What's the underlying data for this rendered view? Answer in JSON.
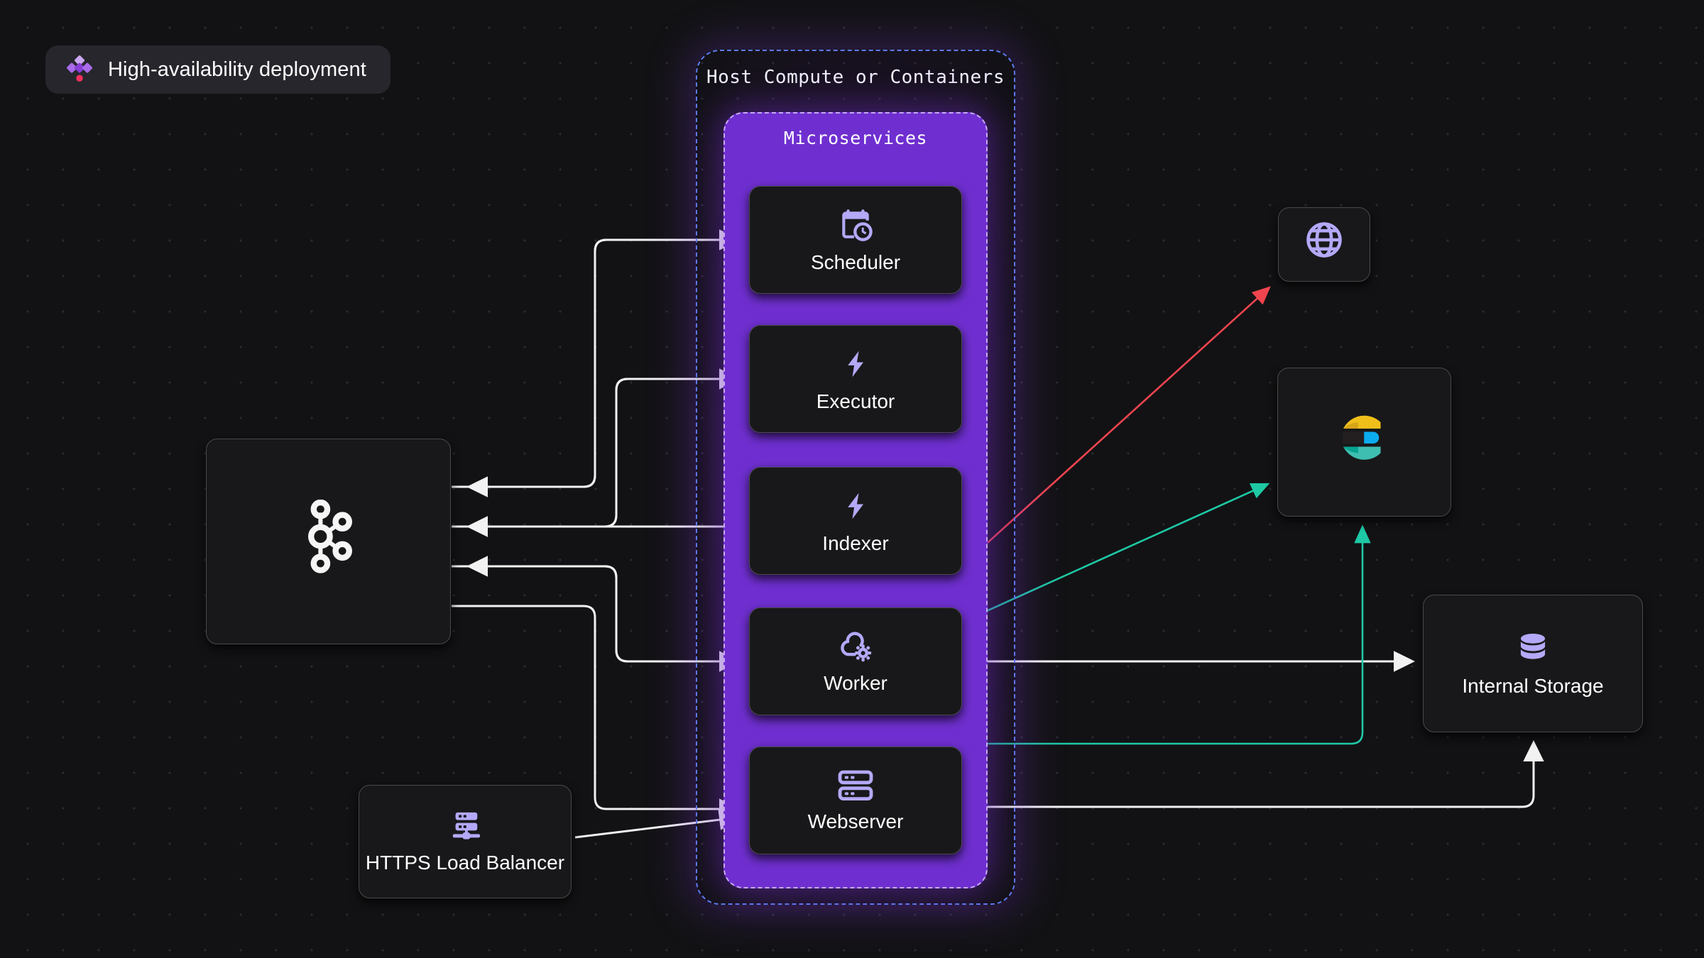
{
  "title_badge": {
    "label": "High-availability deployment",
    "icon": "airflow-diamonds-icon",
    "colors": {
      "diamond_light": "#c9a8f0",
      "diamond_mid": "#a96bea",
      "diamond_dark": "#8a3fd6",
      "dot": "#f0315f"
    }
  },
  "containers": {
    "host": {
      "label": "Host Compute or Containers",
      "border_color": "#5b7cf0",
      "style": "dashed"
    },
    "microservices": {
      "label": "Microservices",
      "fill_color": "#6f2fd0",
      "border_color": "#c6aaf5",
      "style": "dashed"
    }
  },
  "nodes": {
    "scheduler": {
      "label": "Scheduler",
      "icon": "calendar-clock-icon",
      "icon_color": "#b3a9f7"
    },
    "executor": {
      "label": "Executor",
      "icon": "lightning-bolt-icon",
      "icon_color": "#b3a9f7"
    },
    "indexer": {
      "label": "Indexer",
      "icon": "lightning-bolt-icon",
      "icon_color": "#b3a9f7"
    },
    "worker": {
      "label": "Worker",
      "icon": "cloud-gear-icon",
      "icon_color": "#b3a9f7"
    },
    "webserver": {
      "label": "Webserver",
      "icon": "server-rack-icon",
      "icon_color": "#b3a9f7"
    },
    "kafka": {
      "label": "",
      "icon": "kafka-logo-icon",
      "icon_color": "#ffffff"
    },
    "globe": {
      "label": "",
      "icon": "globe-icon",
      "icon_color": "#b3a9f7"
    },
    "elastic": {
      "label": "",
      "icon": "elasticsearch-logo-icon",
      "icon_color": "#00bfb3"
    },
    "storage": {
      "label": "Internal Storage",
      "icon": "database-icon",
      "icon_color": "#b3a9f7"
    },
    "loadbalancer": {
      "label": "HTTPS Load Balancer",
      "icon": "load-balancer-icon",
      "icon_color": "#b3a9f7"
    }
  },
  "edges": {
    "colors": {
      "default": "#f2f2f2",
      "red": "#f0454f",
      "teal": "#1ec8a5"
    },
    "list": [
      {
        "from": "scheduler",
        "to": "kafka",
        "color": "#f2f2f2"
      },
      {
        "from": "executor",
        "to": "kafka",
        "color": "#f2f2f2"
      },
      {
        "from": "indexer",
        "to": "kafka",
        "color": "#f2f2f2"
      },
      {
        "from": "worker",
        "to": "kafka",
        "color": "#f2f2f2"
      },
      {
        "from": "kafka",
        "to": "scheduler",
        "color": "#f2f2f2"
      },
      {
        "from": "kafka",
        "to": "executor",
        "color": "#f2f2f2"
      },
      {
        "from": "kafka",
        "to": "worker",
        "color": "#f2f2f2"
      },
      {
        "from": "kafka",
        "to": "webserver",
        "color": "#f2f2f2"
      },
      {
        "from": "loadbalancer",
        "to": "webserver",
        "color": "#f2f2f2"
      },
      {
        "from": "indexer",
        "to": "globe",
        "color": "#f0454f"
      },
      {
        "from": "worker",
        "to": "elastic",
        "color": "#1ec8a5"
      },
      {
        "from": "webserver",
        "to": "elastic",
        "color": "#1ec8a5"
      },
      {
        "from": "worker",
        "to": "storage",
        "color": "#f2f2f2"
      },
      {
        "from": "webserver",
        "to": "storage",
        "color": "#f2f2f2"
      }
    ]
  }
}
